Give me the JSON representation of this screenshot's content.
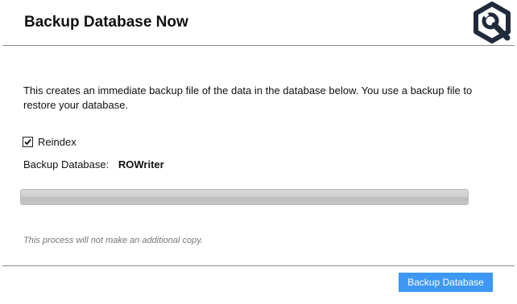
{
  "header": {
    "title": "Backup Database Now",
    "logo_icon": "wrench-shield-logo-icon"
  },
  "main": {
    "description": "This creates an immediate backup file of the data in the database below. You use a backup file to restore your database.",
    "reindex": {
      "label": "Reindex",
      "checked": true
    },
    "database": {
      "label": "Backup Database:",
      "value": "ROWriter"
    },
    "progress": {
      "value": 1.0
    },
    "note": "This process will not make an additional copy."
  },
  "footer": {
    "backup_button_label": "Backup Database"
  },
  "colors": {
    "accent_button": "#3d98f5",
    "logo": "#1f2a3a"
  }
}
